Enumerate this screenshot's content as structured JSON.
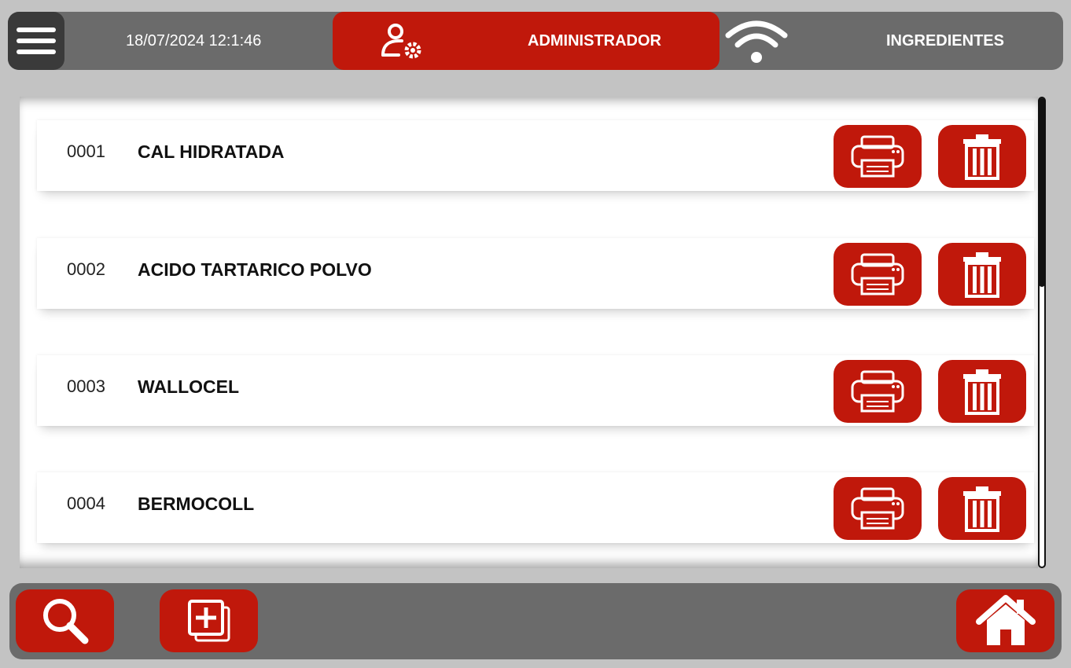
{
  "header": {
    "datetime": "18/07/2024 12:1:46",
    "user_role": "ADMINISTRADOR",
    "section_title": "INGREDIENTES",
    "icons": [
      "menu-icon",
      "user-settings-icon",
      "wifi-icon"
    ]
  },
  "ingredients": [
    {
      "code": "0001",
      "name": "CAL HIDRATADA"
    },
    {
      "code": "0002",
      "name": "ACIDO TARTARICO POLVO"
    },
    {
      "code": "0003",
      "name": "WALLOCEL"
    },
    {
      "code": "0004",
      "name": "BERMOCOLL"
    }
  ],
  "row_actions": [
    "printer-icon",
    "trash-icon"
  ],
  "footer": {
    "icons": [
      "search-icon",
      "add-icon",
      "home-icon"
    ]
  },
  "colors": {
    "accent": "#c0180b",
    "bar": "#6b6b6b",
    "background": "#c3c3c3"
  }
}
